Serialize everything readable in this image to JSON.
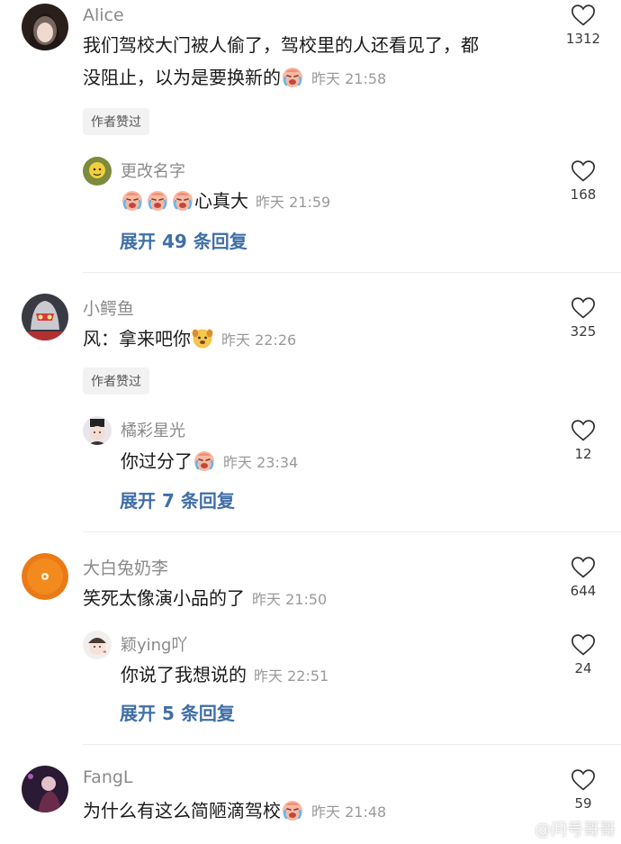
{
  "comments": [
    {
      "user": "Alice",
      "text_line1": "我们驾校大门被人偷了，驾校里的人还看见了，都",
      "text_line2": "没阻止，以为是要换新的",
      "time": "昨天 21:58",
      "likes": "1312",
      "badge": "作者赞过",
      "reply": {
        "user": "更改名字",
        "text": "心真大",
        "time": "昨天 21:59",
        "likes": "168"
      },
      "expand": "展开 49 条回复"
    },
    {
      "user": "小鳄鱼",
      "text": "风：拿来吧你",
      "time": "昨天 22:26",
      "likes": "325",
      "badge": "作者赞过",
      "reply": {
        "user": "橘彩星光",
        "text": "你过分了",
        "time": "昨天 23:34",
        "likes": "12"
      },
      "expand": "展开 7 条回复"
    },
    {
      "user": "大白兔奶李",
      "text": "笑死太像演小品的了",
      "time": "昨天 21:50",
      "likes": "644",
      "reply": {
        "user": "颖ying吖",
        "text": "你说了我想说的",
        "time": "昨天 22:51",
        "likes": "24"
      },
      "expand": "展开 5 条回复"
    },
    {
      "user": "FangL",
      "text": "为什么有这么简陋滴驾校",
      "time": "昨天 21:48",
      "likes": "59"
    }
  ],
  "watermark": "@问号哥哥",
  "colors": {
    "link": "#3f6ea8",
    "muted": "#8a8a8a",
    "badge_bg": "#f2f2f2",
    "divider": "#ececec"
  },
  "icons": [
    "heart-outline-icon",
    "crying-face-emoji",
    "dog-face-emoji"
  ]
}
